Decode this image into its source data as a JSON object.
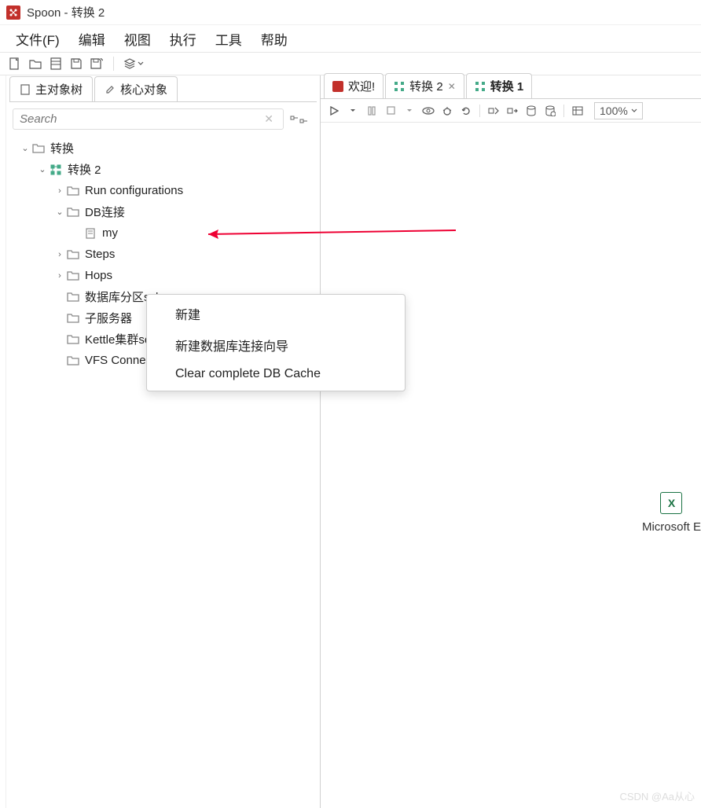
{
  "window": {
    "title": "Spoon - 转换 2"
  },
  "menubar": [
    "文件(F)",
    "编辑",
    "视图",
    "执行",
    "工具",
    "帮助"
  ],
  "left_tabs": [
    {
      "label": "主对象树",
      "icon": "document"
    },
    {
      "label": "核心对象",
      "icon": "pencil"
    }
  ],
  "search": {
    "placeholder": "Search"
  },
  "tree": {
    "root": {
      "label": "转换",
      "expanded": true
    },
    "trans": {
      "label": "转换 2",
      "expanded": true
    },
    "items": [
      {
        "label": "Run configurations",
        "expandable": true
      },
      {
        "label": "DB连接",
        "expandable": true,
        "expanded": true
      },
      {
        "label": "my",
        "child": true
      },
      {
        "label": "Steps",
        "expandable": true
      },
      {
        "label": "Hops",
        "expandable": true
      },
      {
        "label": "数据库分区schemas",
        "expandable": false
      },
      {
        "label": "子服务器",
        "expandable": false
      },
      {
        "label": "Kettle集群schemas",
        "expandable": false
      },
      {
        "label": "VFS Connections",
        "expandable": false
      }
    ]
  },
  "right_tabs": [
    {
      "label": "欢迎!",
      "icon": "red"
    },
    {
      "label": "转换 2",
      "icon": "trans",
      "closable": true
    },
    {
      "label": "转换 1",
      "icon": "trans",
      "bold": true
    }
  ],
  "zoom": "100%",
  "context_menu": [
    "新建",
    "新建数据库连接向导",
    "Clear complete DB Cache"
  ],
  "canvas": {
    "excel_label": "Microsoft E",
    "excel_icon_text": "X"
  },
  "watermark": "CSDN @Aa从心"
}
